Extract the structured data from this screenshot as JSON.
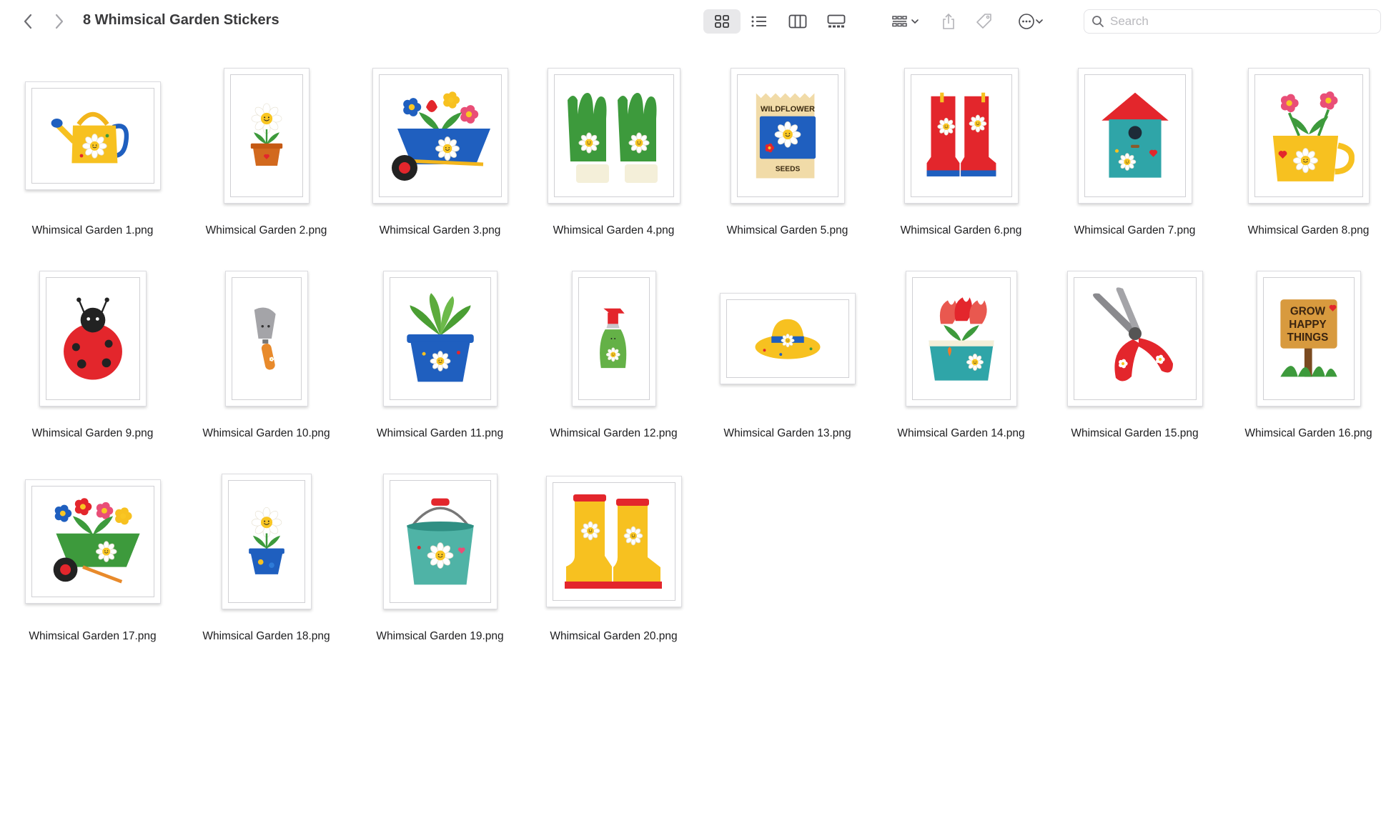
{
  "window": {
    "title": "8 Whimsical Garden Stickers"
  },
  "toolbar": {
    "back_icon": "chevron-left-icon",
    "forward_icon": "chevron-right-icon",
    "view_icons": [
      "icon-view-icon",
      "list-view-icon",
      "column-view-icon",
      "gallery-view-icon"
    ],
    "group_icon": "group-by-icon",
    "share_icon": "share-icon",
    "tag_icon": "tag-icon",
    "more_icon": "more-actions-icon"
  },
  "search": {
    "placeholder": "Search"
  },
  "colors": {
    "accent_red": "#e3262c",
    "accent_yellow": "#f7c120",
    "accent_green": "#3d9a3c",
    "accent_blue": "#1f5fbf",
    "accent_teal": "#2fa5a8"
  },
  "files": [
    {
      "name": "Whimsical Garden 1.png",
      "icon": "watering-can-sticker"
    },
    {
      "name": "Whimsical Garden 2.png",
      "icon": "daisy-pot-sticker"
    },
    {
      "name": "Whimsical Garden 3.png",
      "icon": "flower-wheelbarrow-sticker"
    },
    {
      "name": "Whimsical Garden 4.png",
      "icon": "garden-gloves-sticker"
    },
    {
      "name": "Whimsical Garden 5.png",
      "icon": "seed-packet-sticker",
      "text_top": "WILDFLOWER",
      "text_bottom": "SEEDS"
    },
    {
      "name": "Whimsical Garden 6.png",
      "icon": "red-boots-sticker"
    },
    {
      "name": "Whimsical Garden 7.png",
      "icon": "birdhouse-sticker"
    },
    {
      "name": "Whimsical Garden 8.png",
      "icon": "flower-mug-sticker"
    },
    {
      "name": "Whimsical Garden 9.png",
      "icon": "ladybug-sticker"
    },
    {
      "name": "Whimsical Garden 10.png",
      "icon": "trowel-sticker"
    },
    {
      "name": "Whimsical Garden 11.png",
      "icon": "succulent-pot-sticker"
    },
    {
      "name": "Whimsical Garden 12.png",
      "icon": "spray-bottle-sticker"
    },
    {
      "name": "Whimsical Garden 13.png",
      "icon": "sun-hat-sticker"
    },
    {
      "name": "Whimsical Garden 14.png",
      "icon": "tulip-pot-sticker"
    },
    {
      "name": "Whimsical Garden 15.png",
      "icon": "pruning-shears-sticker"
    },
    {
      "name": "Whimsical Garden 16.png",
      "icon": "grow-happy-sign-sticker",
      "sign_lines": [
        "GROW",
        "HAPPY",
        "THINGS"
      ]
    },
    {
      "name": "Whimsical Garden 17.png",
      "icon": "green-wheelbarrow-sticker"
    },
    {
      "name": "Whimsical Garden 18.png",
      "icon": "blue-daisy-pot-sticker"
    },
    {
      "name": "Whimsical Garden 19.png",
      "icon": "bucket-sticker"
    },
    {
      "name": "Whimsical Garden 20.png",
      "icon": "yellow-boots-sticker"
    }
  ]
}
